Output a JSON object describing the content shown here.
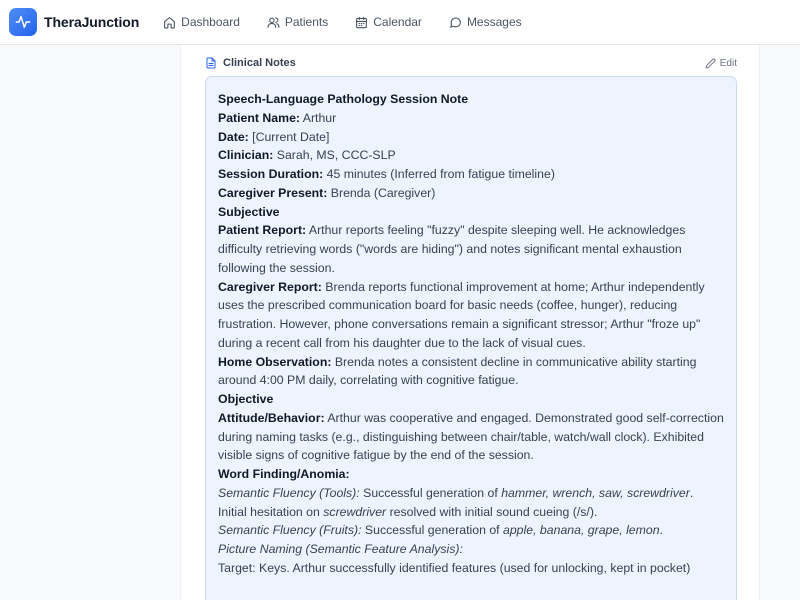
{
  "app": {
    "name": "TheraJunction",
    "logo_icon": "activity-pulse-icon",
    "accent_color": "#2563eb"
  },
  "nav": {
    "items": [
      {
        "label": "Dashboard",
        "icon": "home-icon"
      },
      {
        "label": "Patients",
        "icon": "users-icon"
      },
      {
        "label": "Calendar",
        "icon": "calendar-icon"
      },
      {
        "label": "Messages",
        "icon": "message-circle-icon"
      }
    ]
  },
  "section": {
    "title": "Clinical Notes",
    "edit_label": "Edit",
    "title_icon": "file-text-icon",
    "edit_icon": "pencil-icon"
  },
  "note": {
    "heading": "Speech-Language Pathology Session Note",
    "patient_label": "Patient Name:",
    "patient_value": " Arthur",
    "date_label": "Date:",
    "date_value": " [Current Date]",
    "clinician_label": "Clinician:",
    "clinician_value": " Sarah, MS, CCC-SLP",
    "duration_label": "Session Duration:",
    "duration_value": " 45 minutes (Inferred from fatigue timeline)",
    "caregiver_label": "Caregiver Present:",
    "caregiver_value": " Brenda (Caregiver)",
    "subjective_heading": "Subjective",
    "patient_report_label": "Patient Report:",
    "patient_report_value": " Arthur reports feeling \"fuzzy\" despite sleeping well. He acknowledges difficulty retrieving words (\"words are hiding\") and notes significant mental exhaustion following the session.",
    "caregiver_report_label": "Caregiver Report:",
    "caregiver_report_value": " Brenda reports functional improvement at home; Arthur independently uses the prescribed communication board for basic needs (coffee, hunger), reducing frustration. However, phone conversations remain a significant stressor; Arthur \"froze up\" during a recent call from his daughter due to the lack of visual cues.",
    "home_obs_label": "Home Observation:",
    "home_obs_value": " Brenda notes a consistent decline in communicative ability starting around 4:00 PM daily, correlating with cognitive fatigue.",
    "objective_heading": "Objective",
    "attitude_label": "Attitude/Behavior:",
    "attitude_value": " Arthur was cooperative and engaged. Demonstrated good self-correction during naming tasks (e.g., distinguishing between chair/table, watch/wall clock). Exhibited visible signs of cognitive fatigue by the end of the session.",
    "word_finding_heading": "Word Finding/Anomia:",
    "tools_label": "Semantic Fluency (Tools):",
    "tools_pre": " Successful generation of ",
    "tools_items": "hammer, wrench, saw, screwdriver",
    "tools_post": ". Initial hesitation on ",
    "tools_hes": "screwdriver",
    "tools_end": " resolved with initial sound cueing (/s/).",
    "fruits_label": "Semantic Fluency (Fruits):",
    "fruits_pre": " Successful generation of ",
    "fruits_items": "apple, banana, grape, lemon",
    "fruits_end": ".",
    "naming_label": "Picture Naming (Semantic Feature Analysis):",
    "target_line": "Target: Keys. Arthur successfully identified features (used for unlocking, kept in pocket)"
  }
}
